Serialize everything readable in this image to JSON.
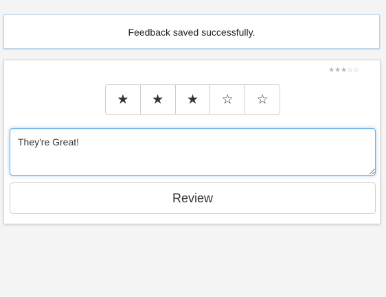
{
  "notification": {
    "message": "Feedback saved successfully."
  },
  "rating": {
    "summary": "★★★☆☆",
    "value": 3,
    "max": 5,
    "stars": [
      "★",
      "★",
      "★",
      "☆",
      "☆"
    ]
  },
  "comment": {
    "value": "They're Great!"
  },
  "actions": {
    "review_label": "Review"
  },
  "colors": {
    "background": "#f4f4f4",
    "focus_border": "#66afe9",
    "star": "#333333",
    "mini_rating": "#b5b5b5"
  }
}
